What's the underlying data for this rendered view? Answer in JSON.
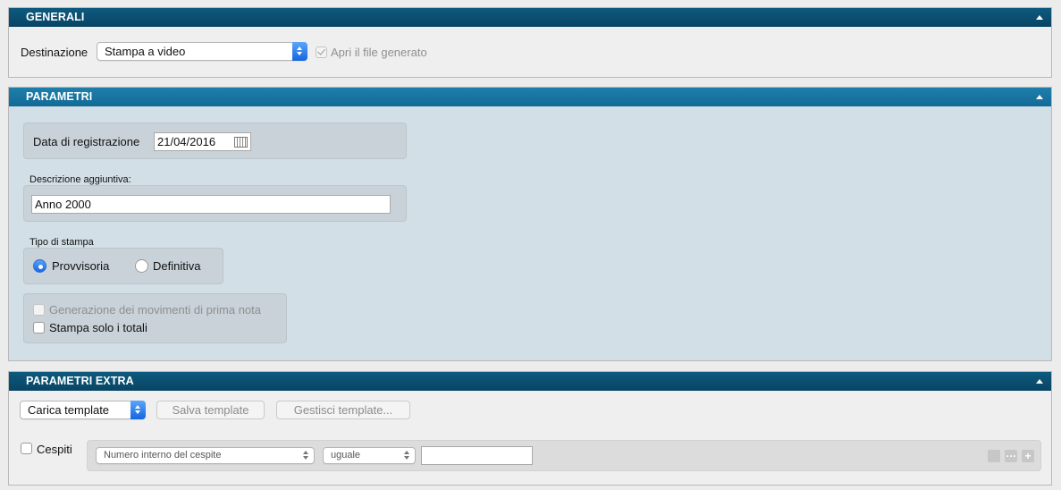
{
  "generali": {
    "title": "GENERALI",
    "destinazione_label": "Destinazione",
    "destinazione_value": "Stampa a video",
    "apri_file_label": "Apri il file generato",
    "apri_file_checked": true
  },
  "parametri": {
    "title": "PARAMETRI",
    "data_label": "Data di registrazione",
    "data_value": "21/04/2016",
    "descrizione_label": "Descrizione aggiuntiva:",
    "descrizione_value": "Anno 2000",
    "tipo_label": "Tipo di stampa",
    "radio_provvisoria": "Provvisoria",
    "radio_definitiva": "Definitiva",
    "selected_tipo": "Provvisoria",
    "generazione_label": "Generazione dei movimenti di prima nota",
    "solo_totali_label": "Stampa solo i totali"
  },
  "extra": {
    "title": "PARAMETRI EXTRA",
    "carica_template": "Carica template",
    "salva_template": "Salva template",
    "gestisci_template": "Gestisci template...",
    "cespiti_label": "Cespiti",
    "filter_field": "Numero interno del cespite",
    "filter_operator": "uguale",
    "filter_value": ""
  },
  "colors": {
    "header_dark": "#0e5a7e",
    "header_light": "#1f7fac",
    "accent_blue": "#1869e2",
    "panel_bg": "#d3dfe6"
  }
}
